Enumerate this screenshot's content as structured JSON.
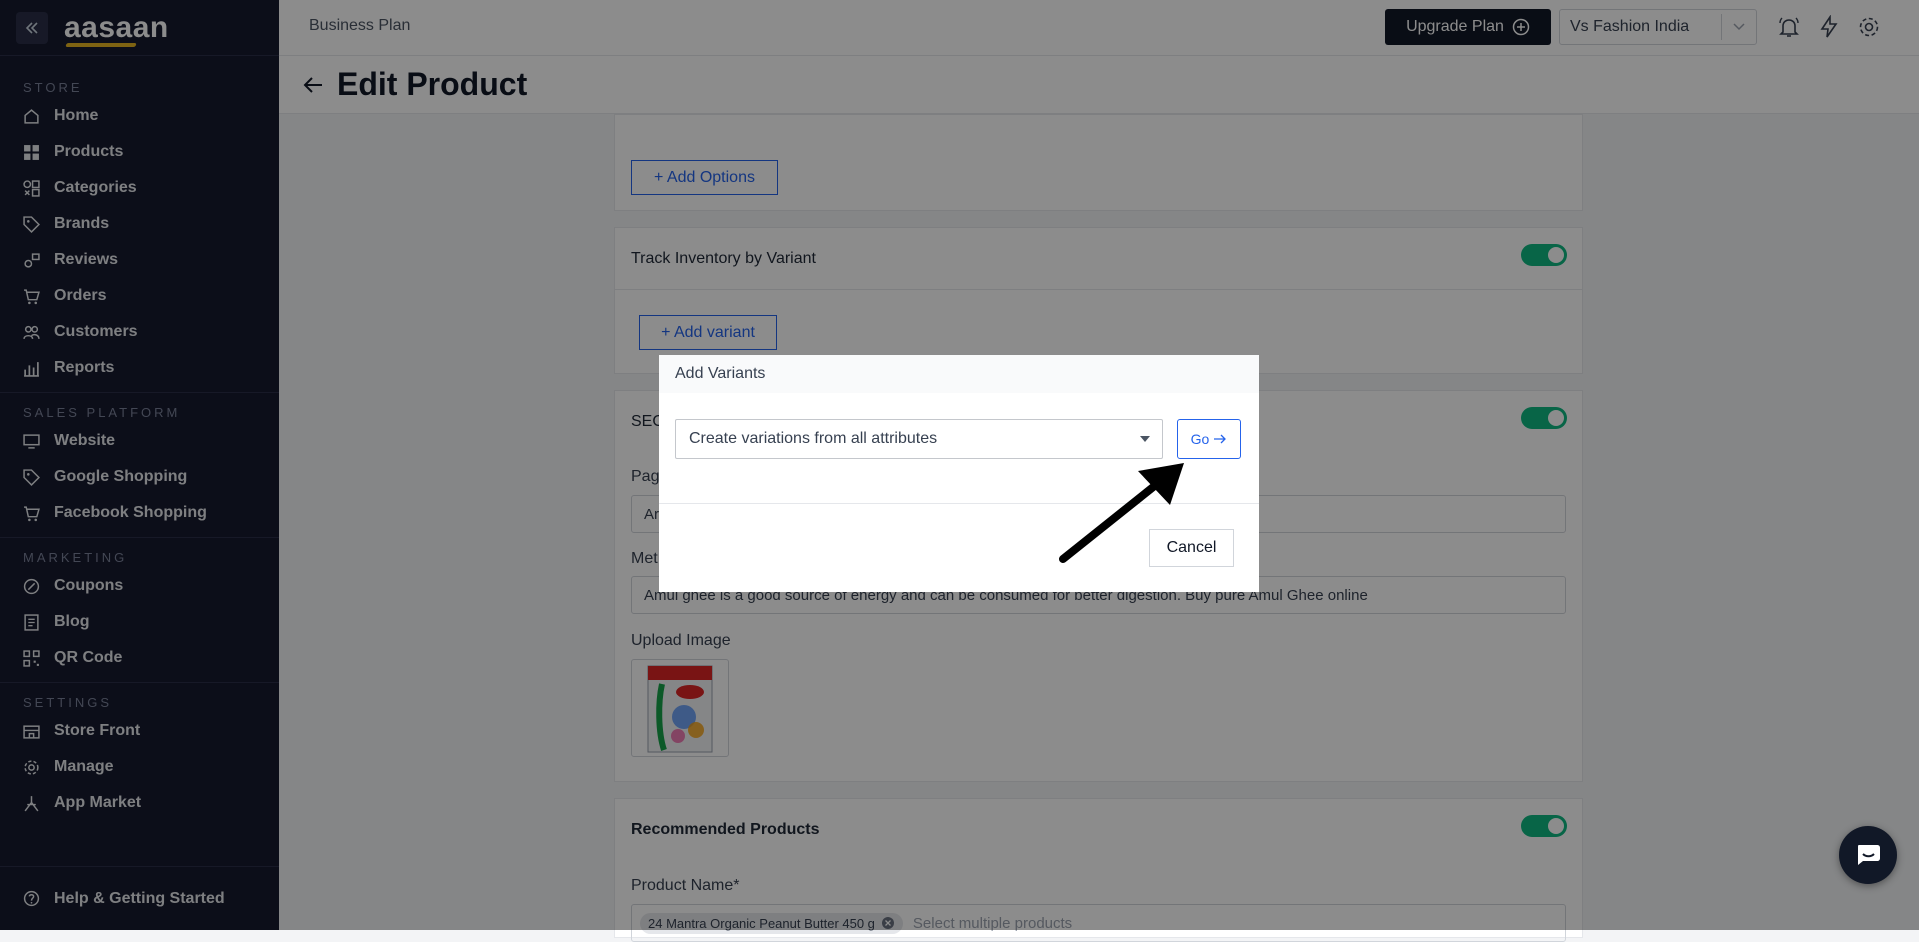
{
  "sidebar": {
    "logo": "aasaan",
    "sections": [
      {
        "label": "STORE",
        "items": [
          "Home",
          "Products",
          "Categories",
          "Brands",
          "Reviews",
          "Orders",
          "Customers",
          "Reports"
        ]
      },
      {
        "label": "SALES PLATFORM",
        "items": [
          "Website",
          "Google Shopping",
          "Facebook Shopping"
        ]
      },
      {
        "label": "MARKETING",
        "items": [
          "Coupons",
          "Blog",
          "QR Code"
        ]
      },
      {
        "label": "SETTINGS",
        "items": [
          "Store Front",
          "Manage",
          "App Market"
        ]
      }
    ],
    "help": "Help & Getting Started"
  },
  "header": {
    "plan": "Business Plan",
    "upgrade": "Upgrade Plan",
    "store": "Vs Fashion India"
  },
  "page": {
    "title": "Edit Product"
  },
  "main": {
    "add_options": "+ Add Options",
    "track_inventory": "Track Inventory by Variant",
    "add_variant": "+ Add variant",
    "seo_title": "SEO",
    "page_title_label": "Pag",
    "page_title_value": "Ar",
    "meta_label": "Met",
    "meta_value": "Amul ghee is a good source of energy and can be consumed for better digestion. Buy pure Amul Ghee online",
    "upload_image": "Upload Image",
    "recommended": "Recommended Products",
    "product_name_label": "Product Name*",
    "selected_product": "24 Mantra Organic Peanut Butter 450 g",
    "select_placeholder": "Select multiple products"
  },
  "modal": {
    "title": "Add Variants",
    "select_value": "Create variations from all attributes",
    "go": "Go",
    "cancel": "Cancel"
  }
}
